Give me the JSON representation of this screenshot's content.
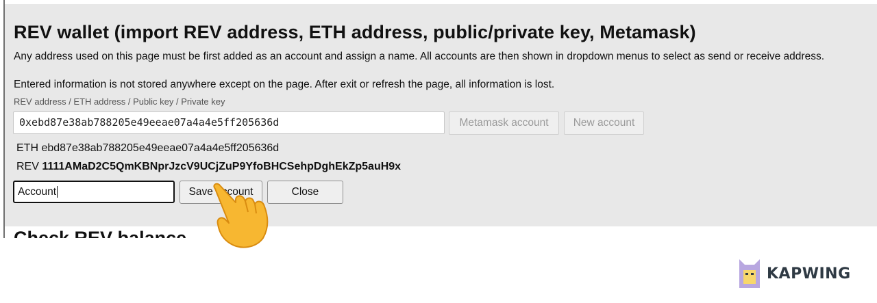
{
  "wallet": {
    "title": "REV wallet (import REV address, ETH address, public/private key, Metamask)",
    "description": "Any address used on this page must be first added as an account and assign a name. All accounts are then shown in dropdown menus to select as send or receive address.",
    "storage_note": "Entered information is not stored anywhere except on the page. After exit or refresh the page, all information is lost.",
    "field_label": "REV address / ETH address / Public key / Private key",
    "address_value": "0xebd87e38ab788205e49eeae07a4a4e5ff205636d",
    "metamask_button": "Metamask account",
    "new_account_button": "New account",
    "eth_label": "ETH",
    "eth_value": "ebd87e38ab788205e49eeae07a4a4e5ff205636d",
    "rev_label": "REV",
    "rev_value": "1111AMaD2C5QmKBNprJzcV9UCjZuP9YfoBHCSehpDghEkZp5auH9x",
    "account_name_value": "Account",
    "save_button": "Save account",
    "close_button": "Close"
  },
  "next_section": {
    "title": "Check REV balance"
  },
  "overlay": {
    "icon": "pointing-hand-icon"
  },
  "watermark": {
    "text": "KAPWING",
    "icon": "kapwing-logo-icon"
  },
  "colors": {
    "panel": "#e8e8e8",
    "hand": "#f7b731",
    "brand_text": "#2f3a44",
    "logo_lavender": "#b8a7e0",
    "logo_yellow": "#f7d76b"
  }
}
